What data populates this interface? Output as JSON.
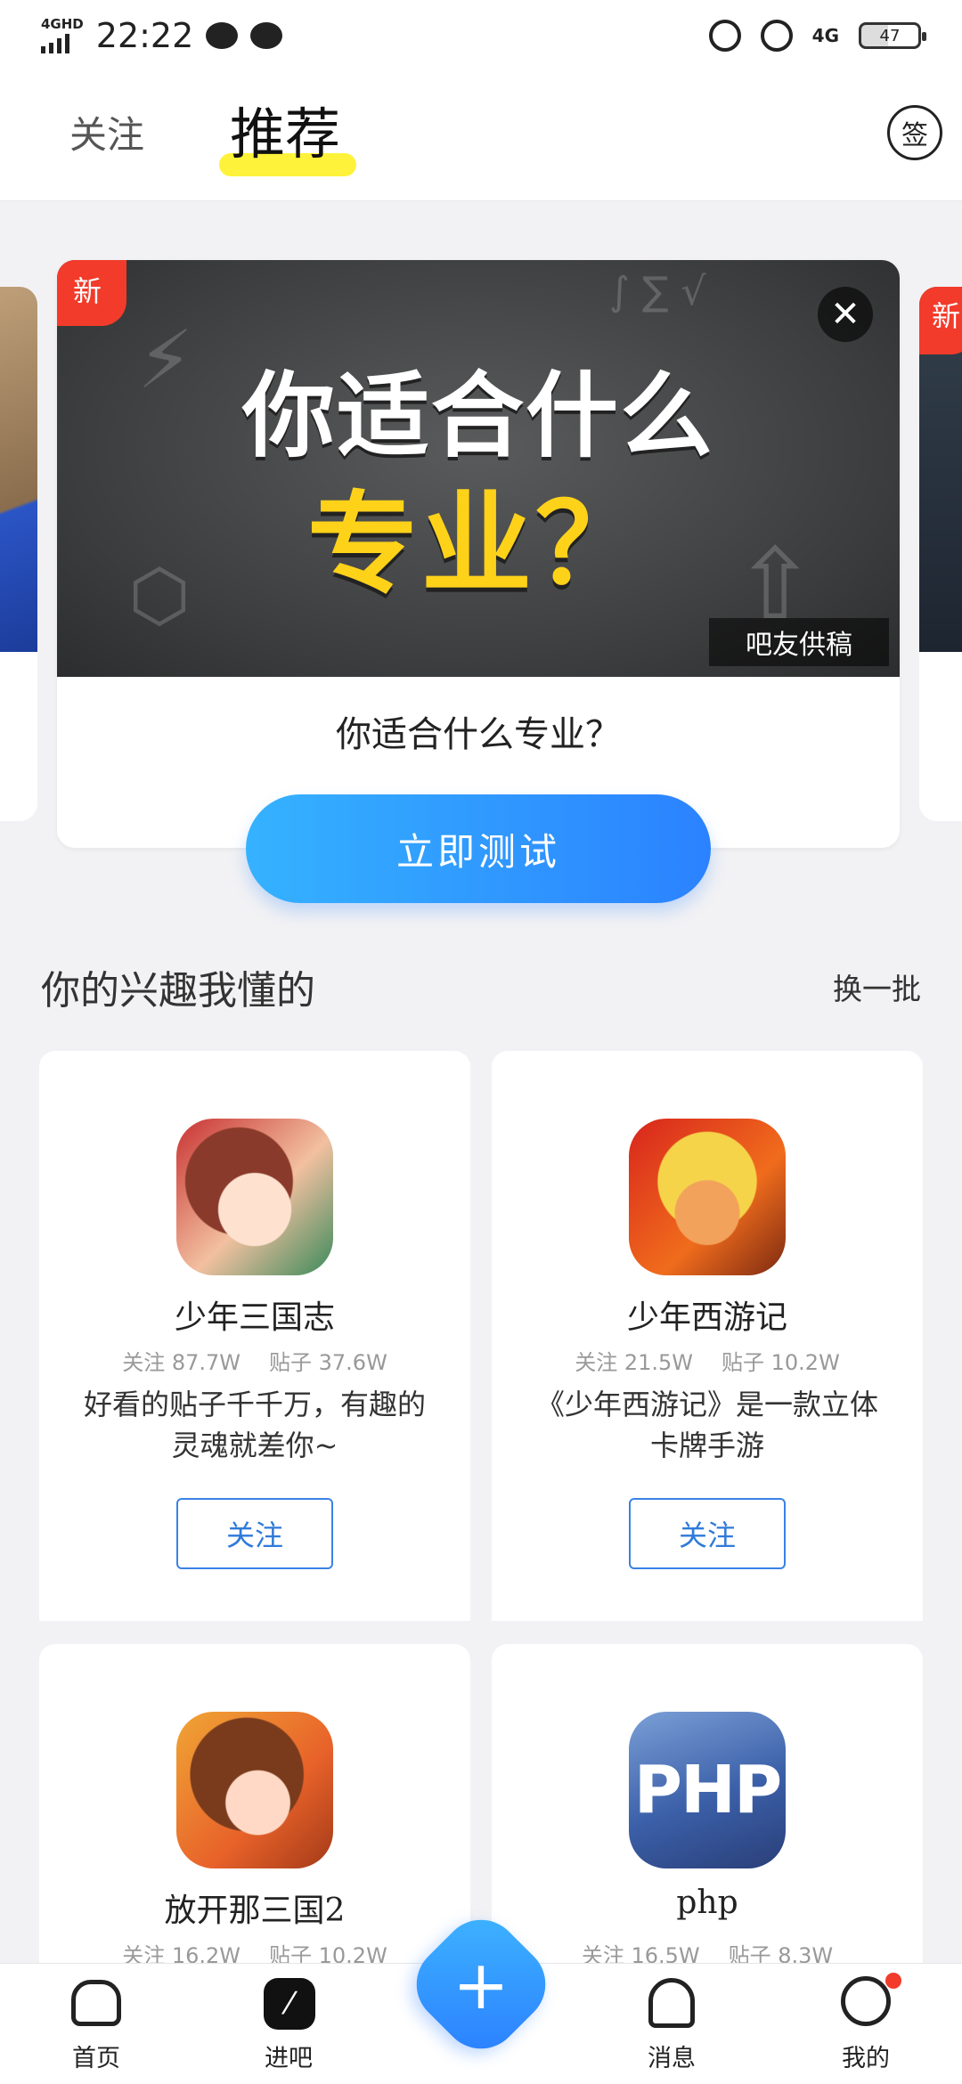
{
  "status_bar": {
    "time": "22:22",
    "network_left": "4GHD",
    "network_right": "4G",
    "battery": "47"
  },
  "header": {
    "tabs": [
      {
        "label": "关注"
      },
      {
        "label": "推荐"
      }
    ],
    "sign_label": "签"
  },
  "banner": {
    "new_tag": "新",
    "headline_line1": "你适合什么",
    "headline_line2": "专业？",
    "credit": "吧友供稿",
    "title": "你适合什么专业？",
    "button_label": "立即测试",
    "close_icon": "close-icon",
    "side_new_tag": "新"
  },
  "section": {
    "title": "你的兴趣我懂的",
    "refresh_label": "换一批"
  },
  "cards": [
    {
      "name": "少年三国志",
      "follow_stat": "关注 87.7W",
      "post_stat": "贴子 37.6W",
      "desc": "好看的贴子千千万，有趣的灵魂就差你~",
      "button": "关注",
      "avatar_text": ""
    },
    {
      "name": "少年西游记",
      "follow_stat": "关注 21.5W",
      "post_stat": "贴子 10.2W",
      "desc": "《少年西游记》是一款立体卡牌手游",
      "button": "关注",
      "avatar_text": ""
    },
    {
      "name": "放开那三国2",
      "follow_stat": "关注 16.2W",
      "post_stat": "贴子 10.2W",
      "desc": "",
      "button": "",
      "avatar_text": ""
    },
    {
      "name": "php",
      "follow_stat": "关注 16.5W",
      "post_stat": "贴子 8.3W",
      "desc": "",
      "button": "",
      "avatar_text": "PHP"
    }
  ],
  "bottom_nav": {
    "items": [
      {
        "label": "首页"
      },
      {
        "label": "进吧"
      },
      {
        "label": "消息"
      },
      {
        "label": "我的"
      }
    ],
    "plus": "+"
  },
  "colors": {
    "accent": "#2b82ff",
    "highlight": "#fff23a",
    "badge": "#f23b2a"
  }
}
